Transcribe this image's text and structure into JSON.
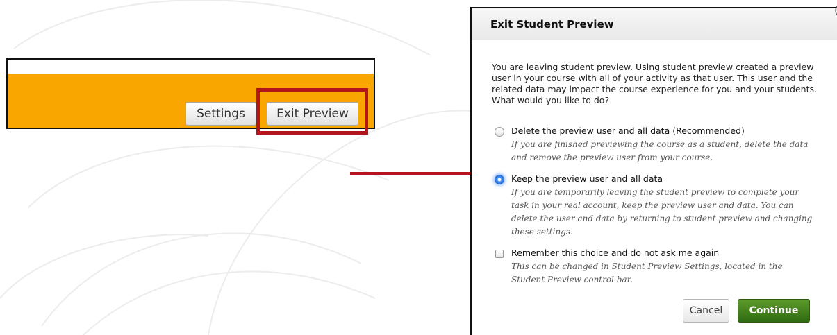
{
  "preview_bar": {
    "settings_label": "Settings",
    "exit_label": "Exit Preview",
    "accent_color": "#f9a600",
    "highlight_color": "#b4141b"
  },
  "dialog": {
    "title": "Exit Student Preview",
    "intro": "You are leaving student preview. Using student preview created a preview user in your course with all of your activity as that user. This user and the related data may impact the course experience for you and your students. What would you like to do?",
    "options": [
      {
        "label": "Delete the preview user and all data (Recommended)",
        "description": "If you are finished previewing the course as a student, delete the data and remove the preview user from your course.",
        "selected": false
      },
      {
        "label": "Keep the preview user and all data",
        "description": "If you are temporarily leaving the student preview to complete your task in your real account, keep the preview user and data. You can delete the user and data by returning to student preview and changing these settings.",
        "selected": true
      }
    ],
    "remember": {
      "label": "Remember this choice and do not ask me again",
      "description": "This can be changed in Student Preview Settings, located in the Student Preview control bar.",
      "checked": false
    },
    "cancel_label": "Cancel",
    "continue_label": "Continue",
    "continue_color": "#3f7d1a"
  },
  "icons": [
    "radio-unselected-icon",
    "radio-selected-icon",
    "checkbox-icon",
    "arrow-right-icon"
  ]
}
